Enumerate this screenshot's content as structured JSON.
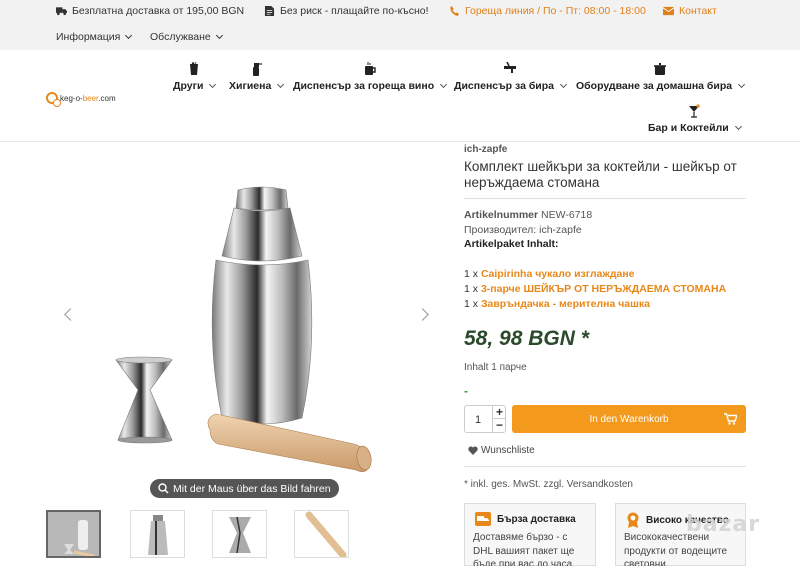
{
  "topbar": {
    "free_shipping": "Безплатна доставка от 195,00 BGN",
    "no_risk": "Без риск - плащайте по-късно!",
    "hotline": "Гореща линия / По - Пт: 08:00 - 18:00",
    "contact": "Контакт",
    "info_menu": "Информация",
    "service_menu": "Обслужване"
  },
  "logo": {
    "prefix": "keg-o-",
    "accent": "beer",
    "suffix": ".com"
  },
  "mainnav": {
    "items": [
      {
        "label": "Други",
        "icon": "drink-glass-icon"
      },
      {
        "label": "Хигиена",
        "icon": "spray-bottle-icon"
      },
      {
        "label": "Диспенсър за гореща вино",
        "icon": "mug-icon"
      },
      {
        "label": "Диспенсър за бира",
        "icon": "beer-tap-icon"
      },
      {
        "label": "Оборудване за домашна бира",
        "icon": "brew-pot-icon"
      },
      {
        "label": "Бар и Коктейли",
        "icon": "cocktail-icon"
      }
    ]
  },
  "gallery": {
    "hint": "Mit der Maus über das Bild fahren"
  },
  "product": {
    "brand": "ich-zapfe",
    "title": "Комплект шейкъри за коктейли - шейкър от неръждаема стомана",
    "artnum_label": "Artikelnummer",
    "artnum_value": "NEW-6718",
    "manufacturer": "Производител: ich-zapfe",
    "package_title": "Artikelpaket Inhalt:",
    "package_items": [
      {
        "qty": "1 x",
        "name": "Caipirinha чукало изглаждане"
      },
      {
        "qty": "1 x",
        "name": "3-парче ШЕЙКЪР ОТ НЕРЪЖДАЕМА СТОМАНА"
      },
      {
        "qty": "1 x",
        "name": "Завръндачка - мерителна чашка"
      }
    ],
    "price": "58, 98 BGN *",
    "content": "Inhalt 1 парче",
    "availability_mark": "-",
    "quantity": "1",
    "plus": "+",
    "minus": "−",
    "cart_button": "In den Warenkorb",
    "wishlist": "Wunschliste",
    "vat_note": "* inkl. ges. MwSt. zzgl. Versandkosten"
  },
  "boxes": [
    {
      "title": "Бърза доставка",
      "text": "Доставяме бързо - с DHL вашият пакет ще бъде при вас до часа",
      "icon": "truck-icon"
    },
    {
      "title": "Високо качество",
      "text": "Висококачествени продукти от водещите световни",
      "icon": "award-badge-icon"
    }
  ],
  "watermark": "bazar",
  "colors": {
    "accent": "#f39a1d",
    "price": "#2b4a2b",
    "link": "#e8881a",
    "topbar_bg": "#f2f2f2"
  }
}
